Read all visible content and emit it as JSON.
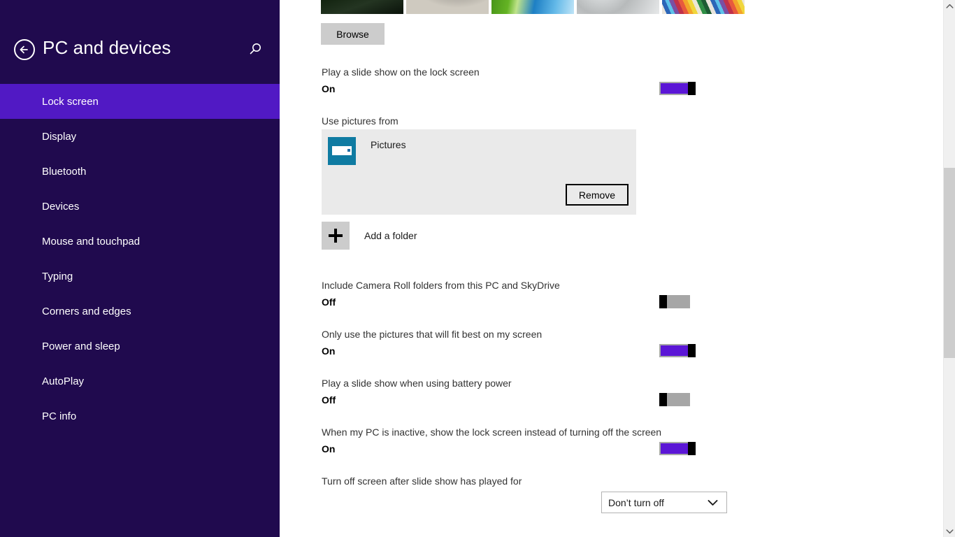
{
  "header": {
    "title": "PC and devices",
    "back_icon": "back-arrow-icon",
    "search_icon": "search-icon"
  },
  "sidebar": {
    "items": [
      {
        "label": "Lock screen",
        "selected": true
      },
      {
        "label": "Display",
        "selected": false
      },
      {
        "label": "Bluetooth",
        "selected": false
      },
      {
        "label": "Devices",
        "selected": false
      },
      {
        "label": "Mouse and touchpad",
        "selected": false
      },
      {
        "label": "Typing",
        "selected": false
      },
      {
        "label": "Corners and edges",
        "selected": false
      },
      {
        "label": "Power and sleep",
        "selected": false
      },
      {
        "label": "AutoPlay",
        "selected": false
      },
      {
        "label": "PC info",
        "selected": false
      }
    ],
    "background_color": "#200a4e",
    "selected_color": "#5119c4"
  },
  "main": {
    "browse_button": "Browse",
    "thumbnails": [
      {
        "name": "thumbnail-dark-field"
      },
      {
        "name": "thumbnail-stone-texture"
      },
      {
        "name": "thumbnail-pool-grass"
      },
      {
        "name": "thumbnail-water-droplets"
      },
      {
        "name": "thumbnail-color-stripes"
      }
    ],
    "settings": [
      {
        "label": "Play a slide show on the lock screen",
        "state": "On",
        "on": true
      },
      {
        "label": "Include Camera Roll folders from this PC and SkyDrive",
        "state": "Off",
        "on": false
      },
      {
        "label": "Only use the pictures that will fit best on my screen",
        "state": "On",
        "on": true
      },
      {
        "label": "Play a slide show when using battery power",
        "state": "Off",
        "on": false
      },
      {
        "label": "When my PC is inactive, show the lock screen instead of turning off the screen",
        "state": "On",
        "on": true
      }
    ],
    "use_pictures_label": "Use pictures from",
    "folder": {
      "name": "Pictures",
      "icon": "pictures-folder-icon",
      "remove_button": "Remove"
    },
    "add_folder": {
      "label": "Add a folder",
      "icon": "plus-icon"
    },
    "turn_off_label": "Turn off screen after slide show has played for",
    "turn_off_value": "Don’t turn off",
    "accent_color": "#5b16d6"
  },
  "scrollbar": {
    "up_icon": "chevron-up-icon",
    "down_icon": "chevron-down-icon"
  }
}
